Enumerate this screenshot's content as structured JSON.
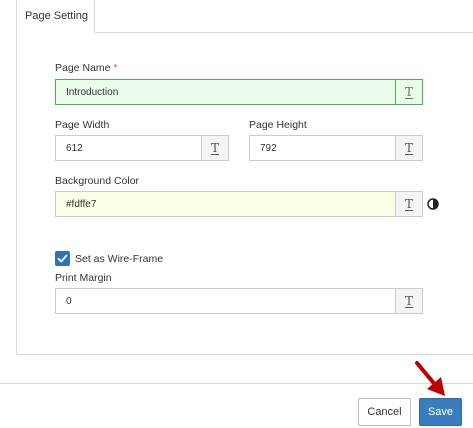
{
  "tab": {
    "label": "Page Setting"
  },
  "page_name": {
    "label": "Page Name",
    "required_marker": "*",
    "value": "Introduction"
  },
  "page_width": {
    "label": "Page Width",
    "value": "612"
  },
  "page_height": {
    "label": "Page Height",
    "value": "792"
  },
  "background_color": {
    "label": "Background Color",
    "value": "#fdffe7"
  },
  "wireframe": {
    "label": "Set as Wire-Frame",
    "checked": true
  },
  "print_margin": {
    "label": "Print Margin",
    "value": "0"
  },
  "text_button_glyph": "T",
  "buttons": {
    "cancel": "Cancel",
    "save": "Save"
  },
  "colors": {
    "accent": "#3a7dbe",
    "field_green_bg": "#ebfbeb",
    "field_green_border": "#4caf50",
    "background_color_preview": "#fdffe7",
    "arrow": "#c00000",
    "required": "#d9534f"
  },
  "icons": {
    "text_format": "text-format-icon",
    "contrast": "contrast-icon",
    "checkmark": "checkmark-icon",
    "arrow": "red-arrow-icon"
  }
}
